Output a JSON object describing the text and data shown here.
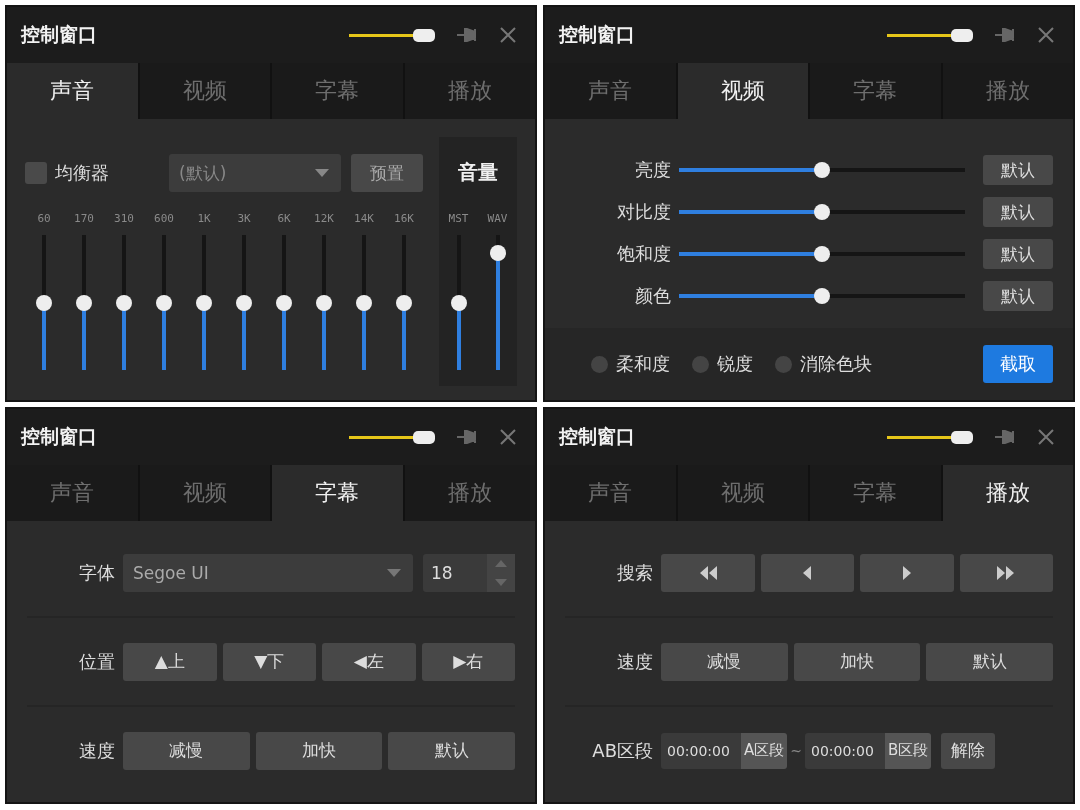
{
  "panels": [
    {
      "title": "控制窗口",
      "opacity": {
        "level": 1
      },
      "tabs": [
        {
          "label": "声音",
          "selected": true
        },
        {
          "label": "视频",
          "selected": false
        },
        {
          "label": "字幕",
          "selected": false
        },
        {
          "label": "播放",
          "selected": false
        }
      ],
      "content": {
        "kind": "audio",
        "equalizer": {
          "label": "均衡器",
          "checked": false
        },
        "preset": {
          "value": "(默认)"
        },
        "preset_button": "预置",
        "bands": [
          {
            "label": "60",
            "level": 0.5
          },
          {
            "label": "170",
            "level": 0.5
          },
          {
            "label": "310",
            "level": 0.5
          },
          {
            "label": "600",
            "level": 0.5
          },
          {
            "label": "1K",
            "level": 0.5
          },
          {
            "label": "3K",
            "level": 0.5
          },
          {
            "label": "6K",
            "level": 0.5
          },
          {
            "label": "12K",
            "level": 0.5
          },
          {
            "label": "14K",
            "level": 0.5
          },
          {
            "label": "16K",
            "level": 0.5
          }
        ],
        "volume": {
          "title": "音量",
          "channels": [
            {
              "label": "MST",
              "level": 0.5
            },
            {
              "label": "WAV",
              "level": 0.92
            }
          ]
        }
      }
    },
    {
      "title": "控制窗口",
      "opacity": {
        "level": 1
      },
      "tabs": [
        {
          "label": "声音",
          "selected": false
        },
        {
          "label": "视频",
          "selected": true
        },
        {
          "label": "字幕",
          "selected": false
        },
        {
          "label": "播放",
          "selected": false
        }
      ],
      "content": {
        "kind": "video",
        "sliders": [
          {
            "label": "亮度",
            "level": 0.5,
            "button": "默认"
          },
          {
            "label": "对比度",
            "level": 0.5,
            "button": "默认"
          },
          {
            "label": "饱和度",
            "level": 0.5,
            "button": "默认"
          },
          {
            "label": "颜色",
            "level": 0.5,
            "button": "默认"
          }
        ],
        "options": [
          {
            "label": "柔和度",
            "checked": false
          },
          {
            "label": "锐度",
            "checked": false
          },
          {
            "label": "消除色块",
            "checked": false
          }
        ],
        "capture_button": "截取"
      }
    },
    {
      "title": "控制窗口",
      "opacity": {
        "level": 1
      },
      "tabs": [
        {
          "label": "声音",
          "selected": false
        },
        {
          "label": "视频",
          "selected": false
        },
        {
          "label": "字幕",
          "selected": true
        },
        {
          "label": "播放",
          "selected": false
        }
      ],
      "content": {
        "kind": "form",
        "rows": [
          {
            "kind": "font",
            "label": "字体",
            "font": "Segoe UI",
            "size": "18"
          },
          {
            "kind": "buttons",
            "label": "位置",
            "buttons": [
              "▲上",
              "▼下",
              "◀左",
              "▶右"
            ]
          },
          {
            "kind": "buttons",
            "label": "速度",
            "buttons": [
              "减慢",
              "加快",
              "默认"
            ]
          }
        ]
      }
    },
    {
      "title": "控制窗口",
      "opacity": {
        "level": 1
      },
      "tabs": [
        {
          "label": "声音",
          "selected": false
        },
        {
          "label": "视频",
          "selected": false
        },
        {
          "label": "字幕",
          "selected": false
        },
        {
          "label": "播放",
          "selected": true
        }
      ],
      "content": {
        "kind": "form",
        "rows": [
          {
            "kind": "icons",
            "label": "搜索",
            "buttons": [
              {
                "kind": "rewind"
              },
              {
                "kind": "back"
              },
              {
                "kind": "forward"
              },
              {
                "kind": "fast-forward"
              }
            ]
          },
          {
            "kind": "buttons",
            "label": "速度",
            "buttons": [
              "减慢",
              "加快",
              "默认"
            ]
          },
          {
            "kind": "ab",
            "label": "AB区段",
            "a": {
              "time": "00:00:00",
              "button": "A区段"
            },
            "separator": "~",
            "b": {
              "time": "00:00:00",
              "button": "B区段"
            },
            "clear_button": "解除"
          }
        ]
      }
    }
  ]
}
